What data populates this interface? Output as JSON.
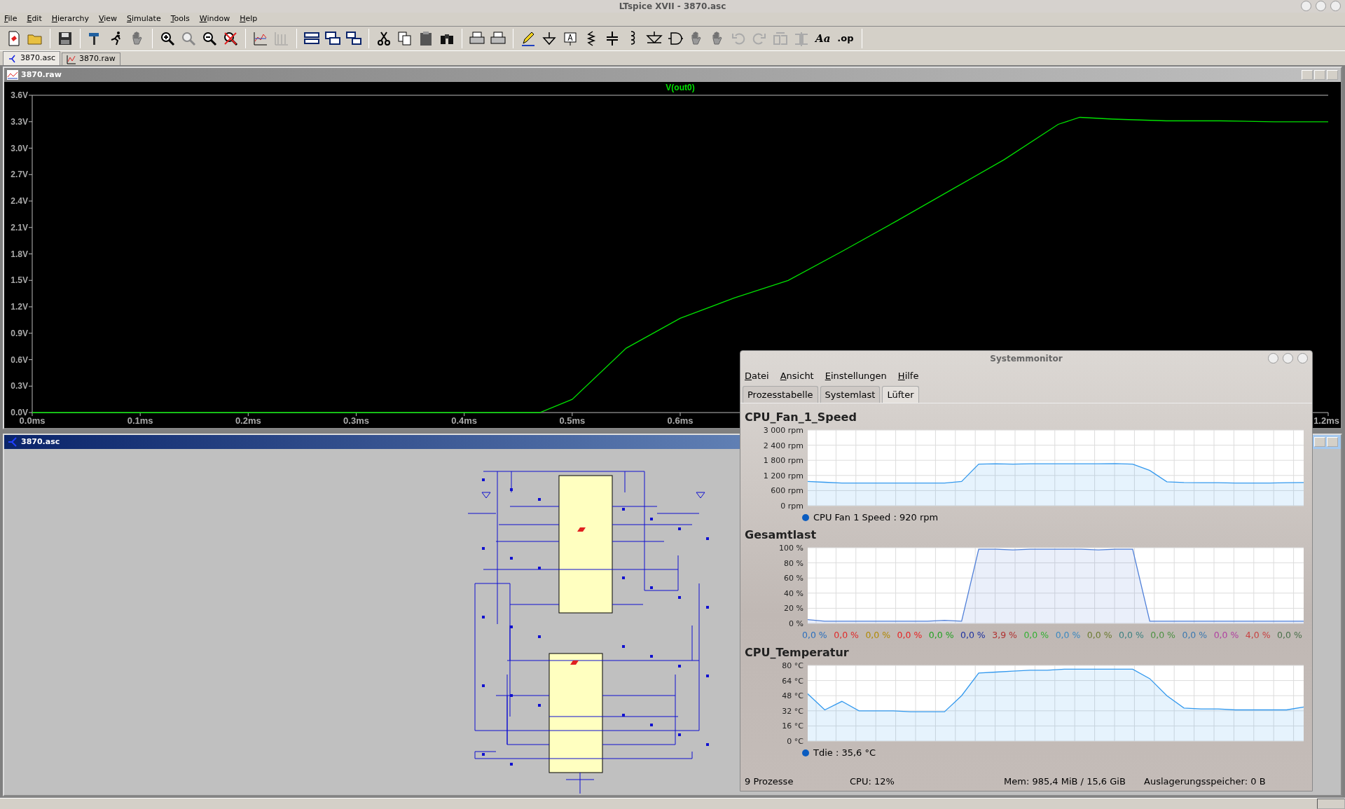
{
  "window": {
    "title": "LTspice XVII - 3870.asc"
  },
  "menu": [
    "File",
    "Edit",
    "Hierarchy",
    "View",
    "Simulate",
    "Tools",
    "Window",
    "Help"
  ],
  "toolbar_text": [
    "Aa",
    ".op"
  ],
  "tabs": [
    {
      "label": "3870.asc",
      "kind": "schematic",
      "selected": true
    },
    {
      "label": "3870.raw",
      "kind": "waveform",
      "selected": false
    }
  ],
  "waveform_window": {
    "title": "3870.raw",
    "chart_data": {
      "type": "line",
      "title": "V(out0)",
      "x": [
        0,
        0.47,
        0.5,
        0.55,
        0.6,
        0.65,
        0.7,
        0.75,
        0.8,
        0.85,
        0.9,
        0.95,
        0.97,
        1.0,
        1.05,
        1.1,
        1.15,
        1.2
      ],
      "series": [
        {
          "color": "#00e000",
          "values": [
            0,
            0,
            0.15,
            0.73,
            1.07,
            1.3,
            1.5,
            1.83,
            2.17,
            2.52,
            2.87,
            3.27,
            3.35,
            3.33,
            3.31,
            3.31,
            3.3,
            3.3
          ]
        }
      ],
      "xlim": [
        0,
        1.2
      ],
      "ylim": [
        0,
        3.6
      ],
      "xticks": [
        {
          "value": 0,
          "label": "0.0ms"
        },
        {
          "value": 0.1,
          "label": "0.1ms"
        },
        {
          "value": 0.2,
          "label": "0.2ms"
        },
        {
          "value": 0.3,
          "label": "0.3ms"
        },
        {
          "value": 0.4,
          "label": "0.4ms"
        },
        {
          "value": 0.5,
          "label": "0.5ms"
        },
        {
          "value": 0.6,
          "label": "0.6ms"
        },
        {
          "value": 1.2,
          "label": "1.2ms"
        }
      ],
      "yticks": [
        {
          "value": 0,
          "label": "0.0V"
        },
        {
          "value": 0.3,
          "label": "0.3V"
        },
        {
          "value": 0.6,
          "label": "0.6V"
        },
        {
          "value": 0.9,
          "label": "0.9V"
        },
        {
          "value": 1.2,
          "label": "1.2V"
        },
        {
          "value": 1.5,
          "label": "1.5V"
        },
        {
          "value": 1.8,
          "label": "1.8V"
        },
        {
          "value": 2.1,
          "label": "2.1V"
        },
        {
          "value": 2.4,
          "label": "2.4V"
        },
        {
          "value": 2.7,
          "label": "2.7V"
        },
        {
          "value": 3.0,
          "label": "3.0V"
        },
        {
          "value": 3.3,
          "label": "3.3V"
        },
        {
          "value": 3.6,
          "label": "3.6V"
        }
      ]
    }
  },
  "schematic_window": {
    "title": "3870.asc"
  },
  "system_monitor": {
    "title": "Systemmonitor",
    "menu": [
      "Datei",
      "Ansicht",
      "Einstellungen",
      "Hilfe"
    ],
    "tabs": [
      {
        "label": "Prozesstabelle",
        "selected": false
      },
      {
        "label": "Systemlast",
        "selected": false
      },
      {
        "label": "Lüfter",
        "selected": true
      }
    ],
    "panels": [
      {
        "title": "CPU_Fan_1_Speed",
        "chart_data": {
          "type": "area",
          "grid": true,
          "ylim": [
            0,
            3000
          ],
          "yticks": [
            {
              "value": 0,
              "label": "0 rpm"
            },
            {
              "value": 600,
              "label": "600 rpm"
            },
            {
              "value": 1200,
              "label": "1 200 rpm"
            },
            {
              "value": 1800,
              "label": "1 800 rpm"
            },
            {
              "value": 2400,
              "label": "2 400 rpm"
            },
            {
              "value": 3000,
              "label": "3 000 rpm"
            }
          ],
          "series": [
            {
              "color": "#3399ee",
              "values": [
                960,
                930,
                900,
                900,
                900,
                900,
                900,
                900,
                900,
                960,
                1650,
                1660,
                1650,
                1660,
                1660,
                1660,
                1660,
                1660,
                1670,
                1650,
                1400,
                950,
                920,
                910,
                910,
                900,
                900,
                900,
                910,
                920
              ]
            }
          ]
        },
        "legend": [
          {
            "kind": "swatch",
            "text": "CPU Fan 1 Speed : 920 rpm",
            "color": "#0a5cc0"
          }
        ]
      },
      {
        "title": "Gesamtlast",
        "chart_data": {
          "type": "area",
          "grid": true,
          "ylim": [
            0,
            100
          ],
          "yticks": [
            {
              "value": 0,
              "label": "0 %"
            },
            {
              "value": 20,
              "label": "20 %"
            },
            {
              "value": 40,
              "label": "40 %"
            },
            {
              "value": 60,
              "label": "60 %"
            },
            {
              "value": 80,
              "label": "80 %"
            },
            {
              "value": 100,
              "label": "100 %"
            }
          ],
          "series": [
            {
              "color": "#4f7fd8",
              "values": [
                5,
                3,
                3,
                3,
                3,
                3,
                3,
                3,
                4,
                3,
                98,
                98,
                97,
                98,
                98,
                98,
                98,
                97,
                98,
                98,
                3,
                3,
                3,
                3,
                3,
                3,
                3,
                3,
                3,
                3
              ]
            }
          ]
        },
        "legend": [
          {
            "kind": "colored_text",
            "text": "0,0 %",
            "color": "#2a6fbd"
          },
          {
            "kind": "colored_text",
            "text": "0,0 %",
            "color": "#e02828"
          },
          {
            "kind": "colored_text",
            "text": "0,0 %",
            "color": "#b08800"
          },
          {
            "kind": "colored_text",
            "text": "0,0 %",
            "color": "#e82020"
          },
          {
            "kind": "colored_text",
            "text": "0,0 %",
            "color": "#20a020"
          },
          {
            "kind": "colored_text",
            "text": "0,0 %",
            "color": "#1a2fa0"
          },
          {
            "kind": "colored_text",
            "text": "3,9 %",
            "color": "#b03030"
          },
          {
            "kind": "colored_text",
            "text": "0,0 %",
            "color": "#30b030"
          },
          {
            "kind": "colored_text",
            "text": "0,0 %",
            "color": "#3a88c0"
          },
          {
            "kind": "colored_text",
            "text": "0,0 %",
            "color": "#6a7a30"
          },
          {
            "kind": "colored_text",
            "text": "0,0 %",
            "color": "#3a8080"
          },
          {
            "kind": "colored_text",
            "text": "0,0 %",
            "color": "#4a9040"
          },
          {
            "kind": "colored_text",
            "text": "0,0 %",
            "color": "#3a78b0"
          },
          {
            "kind": "colored_text",
            "text": "0,0 %",
            "color": "#b040a0"
          },
          {
            "kind": "colored_text",
            "text": "4,0 %",
            "color": "#c84040"
          },
          {
            "kind": "colored_text",
            "text": "0,0 %",
            "color": "#4a704a"
          }
        ]
      },
      {
        "title": "CPU_Temperatur",
        "chart_data": {
          "type": "area",
          "grid": true,
          "ylim": [
            0,
            80
          ],
          "yticks": [
            {
              "value": 0,
              "label": "0 °C"
            },
            {
              "value": 16,
              "label": "16 °C"
            },
            {
              "value": 32,
              "label": "32 °C"
            },
            {
              "value": 48,
              "label": "48 °C"
            },
            {
              "value": 64,
              "label": "64 °C"
            },
            {
              "value": 80,
              "label": "80 °C"
            }
          ],
          "series": [
            {
              "color": "#3399ee",
              "values": [
                50,
                33,
                42,
                32,
                32,
                32,
                31,
                31,
                31,
                48,
                72,
                73,
                74,
                75,
                75,
                76,
                76,
                76,
                76,
                76,
                66,
                48,
                35,
                34,
                34,
                33,
                33,
                33,
                33,
                36
              ]
            }
          ]
        },
        "legend": [
          {
            "kind": "swatch",
            "text": "Tdie : 35,6 °C",
            "color": "#0a5cc0"
          }
        ]
      }
    ],
    "status": [
      "9 Prozesse",
      "CPU: 12%",
      "Mem: 985,4 MiB / 15,6 GiB",
      "Auslagerungsspeicher: 0 B"
    ]
  }
}
